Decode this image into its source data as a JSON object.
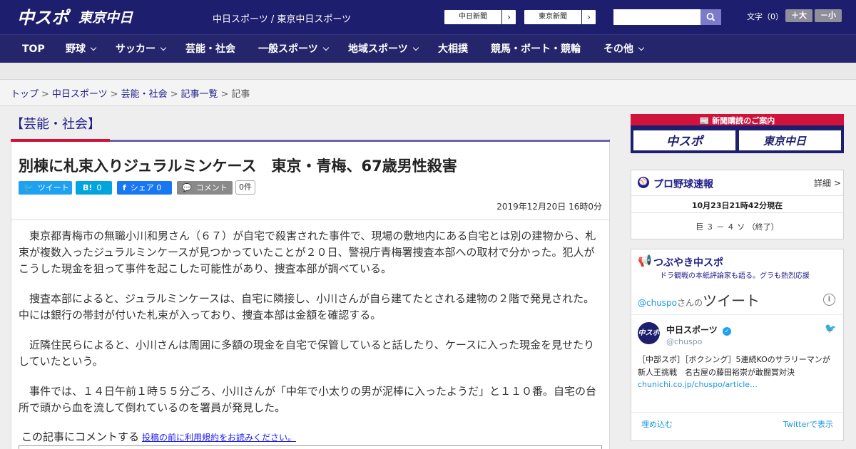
{
  "header": {
    "site_name": "中日スポーツ / 東京中日スポーツ",
    "links": [
      "中日新聞",
      "東京中日スポーツ"
    ],
    "links_short": [
      "中日新聞",
      "東京新聞"
    ],
    "font_size_label": "文字（0）",
    "font_up": "＋大",
    "font_down": "－小"
  },
  "nav": {
    "items": [
      {
        "label": "TOP",
        "has_menu": false
      },
      {
        "label": "野球",
        "has_menu": true
      },
      {
        "label": "サッカー",
        "has_menu": true
      },
      {
        "label": "芸能・社会",
        "has_menu": false
      },
      {
        "label": "一般スポーツ",
        "has_menu": true
      },
      {
        "label": "地域スポーツ",
        "has_menu": true
      },
      {
        "label": "大相撲",
        "has_menu": false
      },
      {
        "label": "競馬・ボート・競輪",
        "has_menu": false
      },
      {
        "label": "その他",
        "has_menu": true
      }
    ]
  },
  "breadcrumb": {
    "items": [
      "トップ",
      "中日スポーツ",
      "芸能・社会",
      "記事一覧"
    ],
    "current": "記事",
    "separator": ">"
  },
  "article": {
    "category": "【芸能・社会】",
    "headline": "別棟に札束入りジュラルミンケース　東京・青梅、67歳男性殺害",
    "share": {
      "tweet": "ツイート",
      "hatena_icon": "B!",
      "hatena_count": "0",
      "fb_share": "シェア",
      "fb_count": "0",
      "comment": "コメント",
      "comment_count": "0件"
    },
    "date": "2019年12月20日 16時0分",
    "paragraphs": [
      "東京都青梅市の無職小川和男さん（６７）が自宅で殺害された事件で、現場の敷地内にある自宅とは別の建物から、札束が複数入ったジュラルミンケースが見つかっていたことが２０日、警視庁青梅署捜査本部への取材で分かった。犯人がこうした現金を狙って事件を起こした可能性があり、捜査本部が調べている。",
      "捜査本部によると、ジュラルミンケースは、自宅に隣接し、小川さんが自ら建てたとされる建物の２階で発見された。中には銀行の帯封が付いた札束が入っており、捜査本部は金額を確認する。",
      "近隣住民らによると、小川さんは周囲に多額の現金を自宅で保管していると話したり、ケースに入った現金を見せたりしていたという。",
      "事件では、１４日午前１時５５分ごろ、小川さんが「中年で小太りの男が泥棒に入ったようだ」と１１０番。自宅の台所で頭から血を流して倒れているのを署員が発見した。"
    ],
    "comment_prompt": "この記事にコメントする",
    "comment_terms_link": "投稿の前に利用規約をお読みください。"
  },
  "sidebar": {
    "subscribe_title": "新聞購読のご案内",
    "paper_logos": [
      "中スポ",
      "東京中日"
    ],
    "baseball": {
      "title": "プロ野球速報",
      "detail_link": "詳細 >",
      "as_of": "10月23日21時42分現在",
      "score": "巨 ３ － ４ ソ （終了）"
    },
    "twitter": {
      "title": "つぶやき中スポ",
      "subtitle": "ドラ観戦の本紙評論家も語る。グラも熱烈応援",
      "handle_link": "@chuspo",
      "handle_suffix": "さんの",
      "tweets_label": "ツイート",
      "account_name": "中日スポーツ",
      "account_handle": "@chuspo",
      "tweet_text": "［中部スポ］［ボクシング］5連続KOのサラリーマンが新人王挑戦　名古屋の藤田裕崇が敢闘賞対決",
      "tweet_link": "chunichi.co.jp/chuspo/article…",
      "embed": "埋め込む",
      "view_on": "Twitterで表示"
    }
  },
  "colors": {
    "header_bg": "#1e1e6e",
    "nav_bg": "#25256b",
    "accent_red": "#d0133a",
    "link_blue": "#1e1e8a",
    "twitter_blue": "#1da1f2",
    "hatena_blue": "#00a4de",
    "facebook_blue": "#1877f2",
    "comment_gray": "#8a8a8a"
  }
}
